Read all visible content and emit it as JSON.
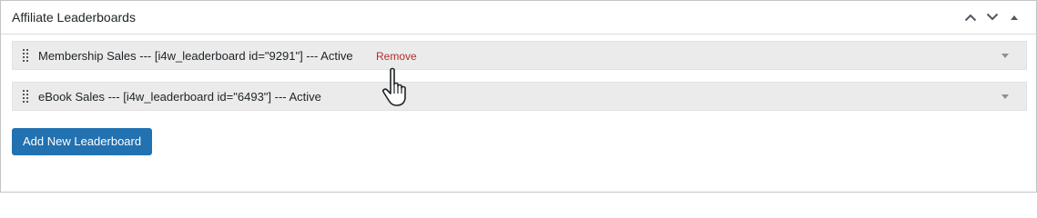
{
  "panel": {
    "title": "Affiliate Leaderboards",
    "controls": {
      "move_up": "chevron-up-icon",
      "move_down": "chevron-down-icon",
      "collapse": "triangle-up-icon"
    }
  },
  "leaderboards": [
    {
      "label": "Membership Sales --- [i4w_leaderboard id=\"9291\"] --- Active",
      "remove_label": "Remove"
    },
    {
      "label": "eBook Sales --- [i4w_leaderboard id=\"6493\"] --- Active"
    }
  ],
  "add_button_label": "Add New Leaderboard",
  "colors": {
    "accent": "#2271b1",
    "remove": "#b32d2e",
    "row_bg": "#ebebeb",
    "border": "#c3c4c7"
  }
}
